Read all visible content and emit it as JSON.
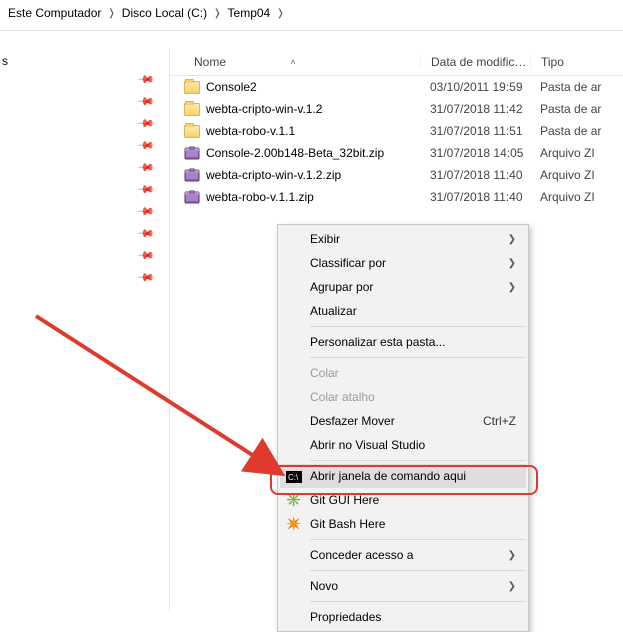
{
  "breadcrumb": {
    "seg1": "Este Computador",
    "seg2": "Disco Local (C:)",
    "seg3": "Temp04"
  },
  "left_label_trunc": "s",
  "columns": {
    "name": "Nome",
    "date": "Data de modificaç...",
    "type": "Tipo"
  },
  "rows": [
    {
      "kind": "folder",
      "name": "Console2",
      "date": "03/10/2011 19:59",
      "type": "Pasta de ar"
    },
    {
      "kind": "folder",
      "name": "webta-cripto-win-v.1.2",
      "date": "31/07/2018 11:42",
      "type": "Pasta de ar"
    },
    {
      "kind": "folder",
      "name": "webta-robo-v.1.1",
      "date": "31/07/2018 11:51",
      "type": "Pasta de ar"
    },
    {
      "kind": "zip",
      "name": "Console-2.00b148-Beta_32bit.zip",
      "date": "31/07/2018 14:05",
      "type": "Arquivo ZI"
    },
    {
      "kind": "zip",
      "name": "webta-cripto-win-v.1.2.zip",
      "date": "31/07/2018 11:40",
      "type": "Arquivo ZI"
    },
    {
      "kind": "zip",
      "name": "webta-robo-v.1.1.zip",
      "date": "31/07/2018 11:40",
      "type": "Arquivo ZI"
    }
  ],
  "ctx": {
    "exibir": "Exibir",
    "classificar": "Classificar por",
    "agrupar": "Agrupar por",
    "atualizar": "Atualizar",
    "personalizar": "Personalizar esta pasta...",
    "colar": "Colar",
    "colar_atalho": "Colar atalho",
    "desfazer": "Desfazer Mover",
    "desfazer_kb": "Ctrl+Z",
    "abrir_vs": "Abrir no Visual Studio",
    "abrir_cmd": "Abrir janela de comando aqui",
    "git_gui": "Git GUI Here",
    "git_bash": "Git Bash Here",
    "conceder": "Conceder acesso a",
    "novo": "Novo",
    "propriedades": "Propriedades"
  }
}
